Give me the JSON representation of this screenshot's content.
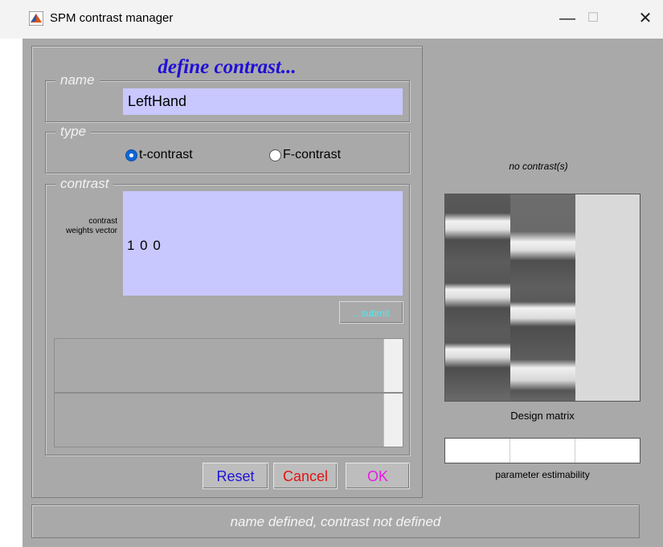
{
  "window": {
    "title": "SPM contrast manager",
    "controls": {
      "minimize": "—",
      "maximize": "☐",
      "close": "✕"
    }
  },
  "define_panel": {
    "title": "define contrast...",
    "name_group": {
      "legend": "name",
      "value": "LeftHand"
    },
    "type_group": {
      "legend": "type",
      "options": [
        {
          "label": "t-contrast",
          "selected": true
        },
        {
          "label": "F-contrast",
          "selected": false
        }
      ]
    },
    "contrast_group": {
      "legend": "contrast",
      "weights_label": "contrast weights vector",
      "weights_value": "1 0 0",
      "submit_label": "...submit"
    }
  },
  "buttons": {
    "reset": {
      "label": "Reset",
      "color": "#1f14d8"
    },
    "cancel": {
      "label": "Cancel",
      "color": "#e01414"
    },
    "ok": {
      "label": "OK",
      "color": "#e81ae8"
    }
  },
  "right_panel": {
    "no_contrast_text": "no contrast(s)",
    "design_matrix_label": "Design matrix",
    "estimability_label": "parameter estimability",
    "estimability_columns": 3
  },
  "status": {
    "text": "name defined, contrast not defined"
  },
  "colors": {
    "window_bg": "#a9a9a9",
    "field_bg": "#c8c8ff",
    "title_blue": "#1f0fd6",
    "submit_text": "#55e8ee"
  }
}
